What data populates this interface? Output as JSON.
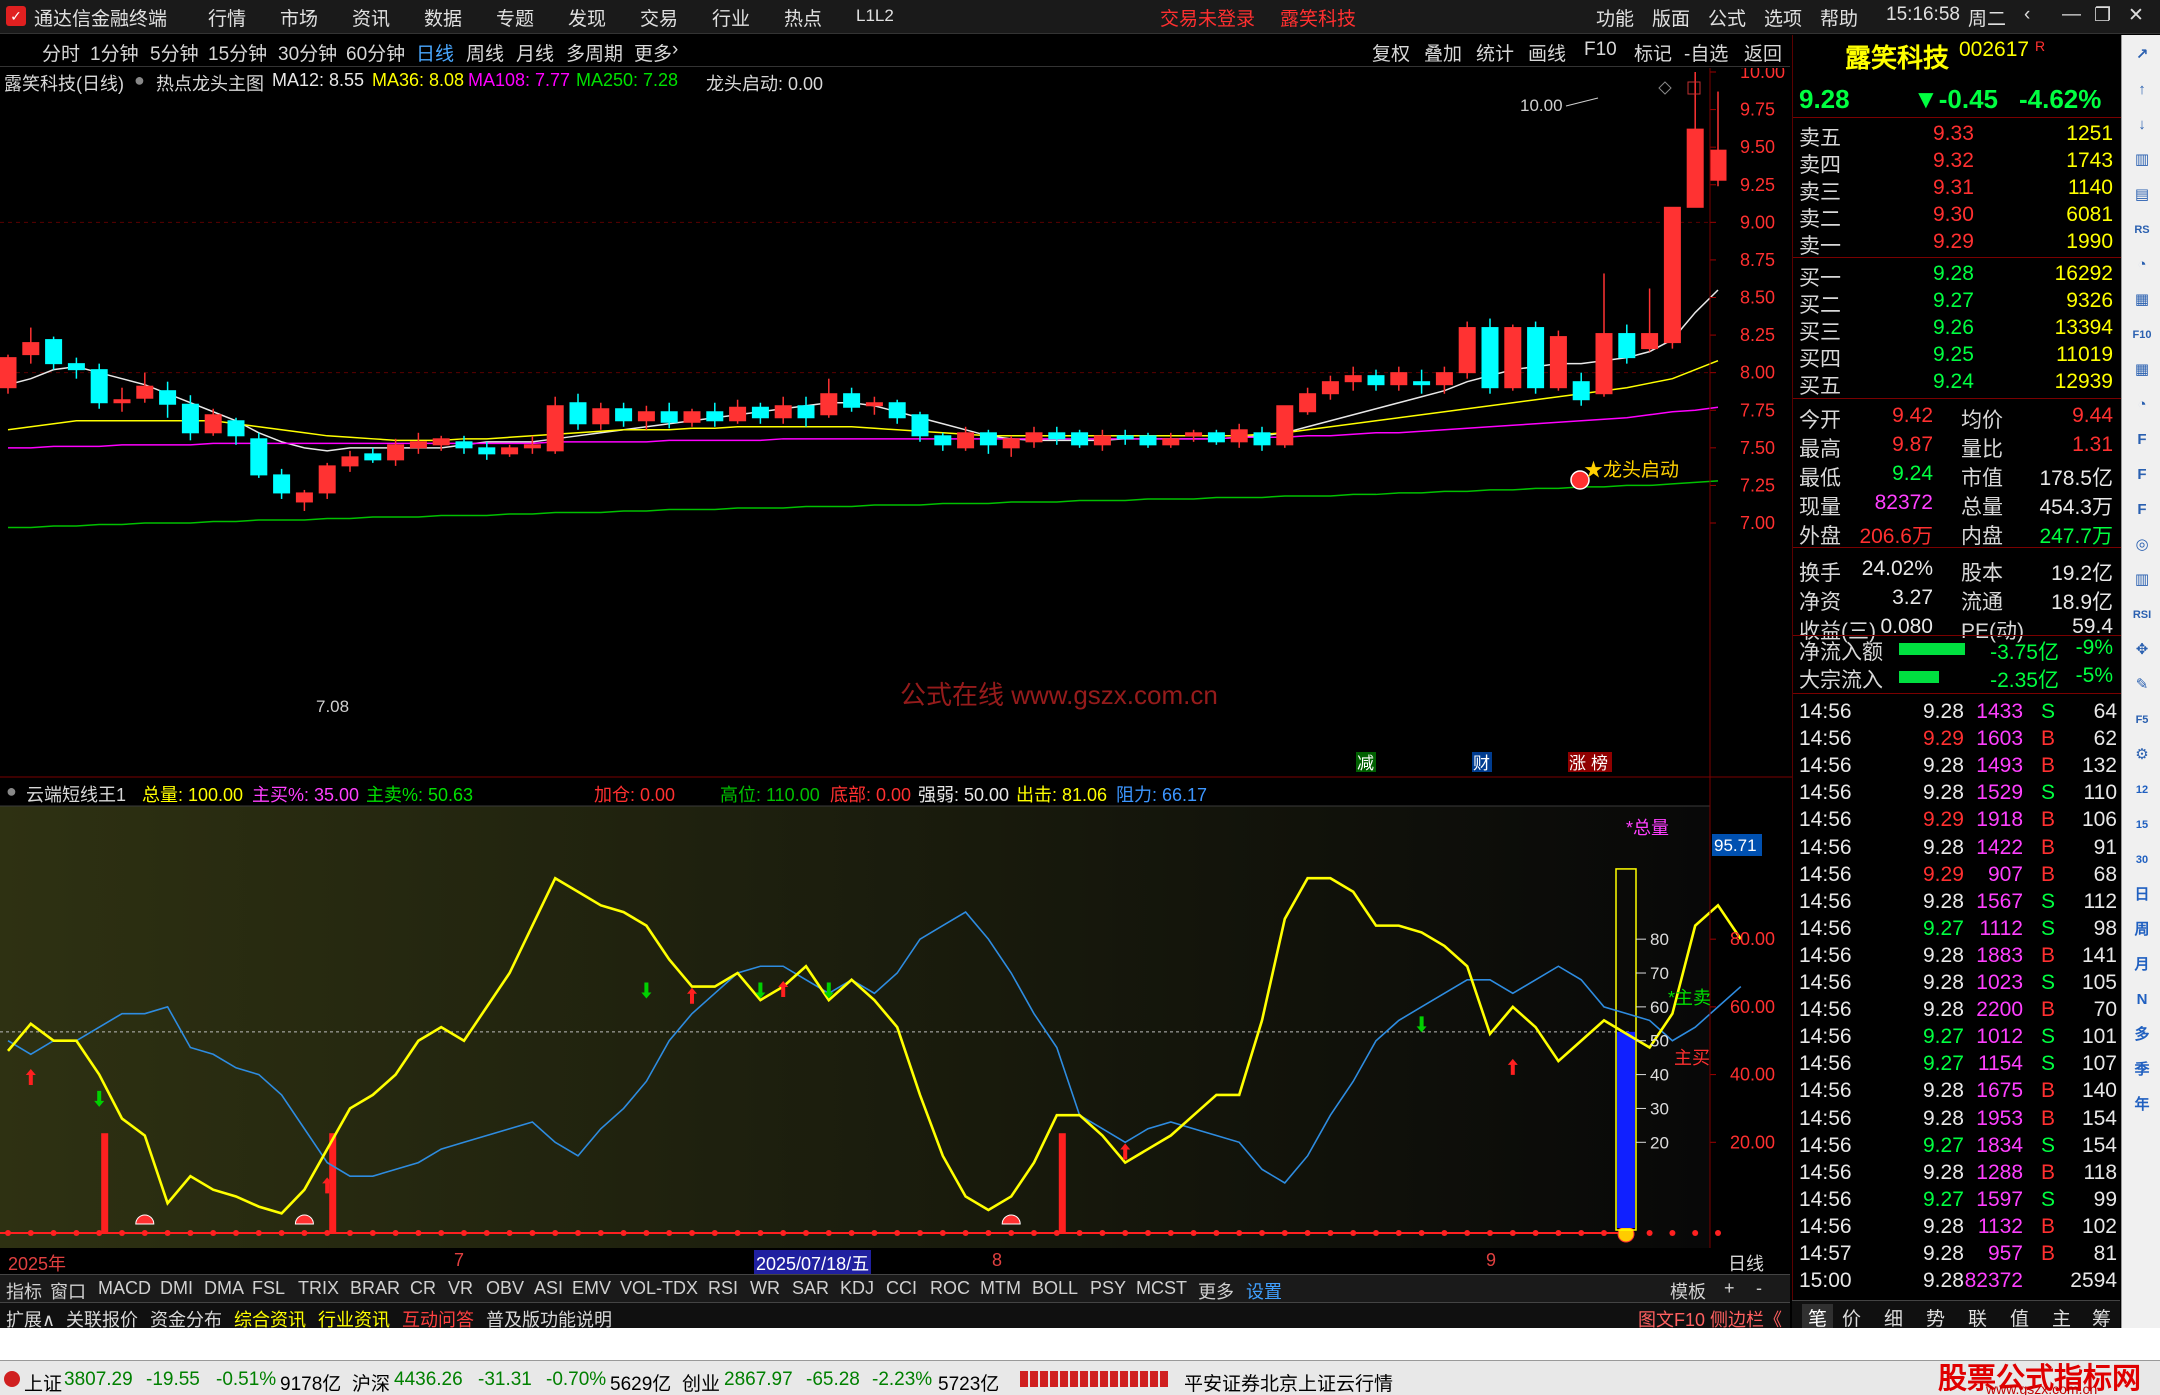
{
  "app": {
    "title": "通达信金融终端",
    "menu": [
      "行情",
      "市场",
      "资讯",
      "数据",
      "专题",
      "发现",
      "交易",
      "行业",
      "热点",
      "L1L2"
    ],
    "trade_status": "交易未登录",
    "stock_name": "露笑科技",
    "right_menu": [
      "功能",
      "版面",
      "公式",
      "选项",
      "帮助"
    ],
    "clock": "15:16:58",
    "weekday": "周二"
  },
  "periods": {
    "items": [
      "分时",
      "1分钟",
      "5分钟",
      "15分钟",
      "30分钟",
      "60分钟",
      "日线",
      "周线",
      "月线",
      "多周期",
      "更多"
    ],
    "active": "日线",
    "tools": [
      "复权",
      "叠加",
      "统计",
      "画线",
      "F10",
      "标记",
      "-自选",
      "返回"
    ]
  },
  "main_info": {
    "title": "露笑科技(日线)",
    "template": "热点龙头主图",
    "ma12": "MA12: 8.55",
    "ma36": "MA36: 8.08",
    "ma108": "MA108: 7.77",
    "ma250": "MA250: 7.28",
    "signal": "龙头启动: 0.00",
    "hi_label": "10.00",
    "lo_label": "7.08",
    "marker_label": "★龙头启动",
    "watermark": "公式在线  www.gszx.com.cn",
    "badges": [
      "减",
      "财",
      "涨",
      "榜"
    ]
  },
  "price_axis": [
    "10.00",
    "9.75",
    "9.50",
    "9.25",
    "9.00",
    "8.75",
    "8.50",
    "8.25",
    "8.00",
    "7.75",
    "7.50",
    "7.25",
    "7.00"
  ],
  "sub_info": {
    "name": "云端短线王1",
    "total": "总量: 100.00",
    "buy_pct": "主买%: 35.00",
    "sell_pct": "主卖%: 50.63",
    "add": "加仓: 0.00",
    "high": "高位: 110.00",
    "bottom": "底部: 0.00",
    "strong": "强弱: 50.00",
    "out": "出击: 81.06",
    "resist": "阻力: 66.17",
    "flag_total": "*总量",
    "flag_sell": "*主卖",
    "flag_buy": "主买",
    "value_tag": "95.71"
  },
  "sub_axis": [
    "80.00",
    "60.00",
    "40.00",
    "20.00"
  ],
  "sub_inner_axis": [
    "80",
    "70",
    "60",
    "50",
    "40",
    "30",
    "20"
  ],
  "dates": {
    "year": "2025年",
    "m7": "7",
    "cursor": "2025/07/18/五",
    "m8": "8",
    "m9": "9",
    "period": "日线"
  },
  "indicator_tabs": [
    "指标",
    "窗口",
    "MACD",
    "DMI",
    "DMA",
    "FSL",
    "TRIX",
    "BRAR",
    "CR",
    "VR",
    "OBV",
    "ASI",
    "EMV",
    "VOL-TDX",
    "RSI",
    "WR",
    "SAR",
    "KDJ",
    "CCI",
    "ROC",
    "MTM",
    "BOLL",
    "PSY",
    "MCST",
    "更多",
    "设置"
  ],
  "indicator_right": [
    "模板",
    "+",
    "-"
  ],
  "ext_tabs": [
    "扩展∧",
    "关联报价",
    "资金分布",
    "综合资讯",
    "行业资讯",
    "互动问答",
    "普及版功能说明"
  ],
  "ext_right": "图文F10 侧边栏《",
  "quote": {
    "name": "露笑科技",
    "code": "002617",
    "flag": "R",
    "price": "9.28",
    "change": "▼-0.45",
    "pct": "-4.62%"
  },
  "asks": [
    [
      "卖五",
      "9.33",
      "1251"
    ],
    [
      "卖四",
      "9.32",
      "1743"
    ],
    [
      "卖三",
      "9.31",
      "1140"
    ],
    [
      "卖二",
      "9.30",
      "6081"
    ],
    [
      "卖一",
      "9.29",
      "1990"
    ]
  ],
  "bids": [
    [
      "买一",
      "9.28",
      "16292"
    ],
    [
      "买二",
      "9.27",
      "9326"
    ],
    [
      "买三",
      "9.26",
      "13394"
    ],
    [
      "买四",
      "9.25",
      "11019"
    ],
    [
      "买五",
      "9.24",
      "12939"
    ]
  ],
  "stats": [
    [
      "今开",
      "9.42",
      "均价",
      "9.44"
    ],
    [
      "最高",
      "9.87",
      "量比",
      "1.31"
    ],
    [
      "最低",
      "9.24",
      "市值",
      "178.5亿"
    ],
    [
      "现量",
      "82372",
      "总量",
      "454.3万"
    ],
    [
      "外盘",
      "206.6万",
      "内盘",
      "247.7万"
    ],
    [
      "换手",
      "24.02%",
      "股本",
      "19.2亿"
    ],
    [
      "净资",
      "3.27",
      "流通",
      "18.9亿"
    ],
    [
      "收益(三)",
      "0.080",
      "PE(动)",
      "59.4"
    ]
  ],
  "flows": [
    [
      "净流入额",
      "-3.75亿",
      "-9%"
    ],
    [
      "大宗流入",
      "-2.35亿",
      "-5%"
    ]
  ],
  "ticks": [
    [
      "14:56",
      "9.28",
      "1433",
      "S",
      "64"
    ],
    [
      "14:56",
      "9.29",
      "1603",
      "B",
      "62"
    ],
    [
      "14:56",
      "9.28",
      "1493",
      "B",
      "132"
    ],
    [
      "14:56",
      "9.28",
      "1529",
      "S",
      "110"
    ],
    [
      "14:56",
      "9.29",
      "1918",
      "B",
      "106"
    ],
    [
      "14:56",
      "9.28",
      "1422",
      "B",
      "91"
    ],
    [
      "14:56",
      "9.29",
      "907",
      "B",
      "68"
    ],
    [
      "14:56",
      "9.28",
      "1567",
      "S",
      "112"
    ],
    [
      "14:56",
      "9.27",
      "1112",
      "S",
      "98"
    ],
    [
      "14:56",
      "9.28",
      "1883",
      "B",
      "141"
    ],
    [
      "14:56",
      "9.28",
      "1023",
      "S",
      "105"
    ],
    [
      "14:56",
      "9.28",
      "2200",
      "B",
      "70"
    ],
    [
      "14:56",
      "9.27",
      "1012",
      "S",
      "101"
    ],
    [
      "14:56",
      "9.27",
      "1154",
      "S",
      "107"
    ],
    [
      "14:56",
      "9.28",
      "1675",
      "B",
      "140"
    ],
    [
      "14:56",
      "9.28",
      "1953",
      "B",
      "154"
    ],
    [
      "14:56",
      "9.27",
      "1834",
      "S",
      "154"
    ],
    [
      "14:56",
      "9.28",
      "1288",
      "B",
      "118"
    ],
    [
      "14:56",
      "9.27",
      "1597",
      "S",
      "99"
    ],
    [
      "14:56",
      "9.28",
      "1132",
      "B",
      "102"
    ],
    [
      "14:57",
      "9.28",
      "957",
      "B",
      "81"
    ],
    [
      "15:00",
      "9.28",
      "82372",
      "",
      "2594"
    ]
  ],
  "right_tabs": [
    "笔",
    "价",
    "细",
    "势",
    "联",
    "值",
    "主",
    "筹"
  ],
  "side_icons": [
    "↗",
    "↑",
    "↓",
    "▥",
    "▤",
    "RS",
    "◔",
    "▦",
    "F10",
    "▦",
    "◔",
    "F",
    "F",
    "F",
    "◎",
    "▥",
    "RSI",
    "✥",
    "✎",
    "F5",
    "⚙",
    "12",
    "15",
    "30",
    "日",
    "周",
    "月",
    "N",
    "多",
    "季",
    "年"
  ],
  "status": {
    "sh_name": "上证",
    "sh_val": "3807.29",
    "sh_chg": "-19.55",
    "sh_pct": "-0.51%",
    "sh_amt": "9178亿",
    "sz_name": "沪深",
    "sz_val": "4436.26",
    "sz_chg": "-31.31",
    "sz_pct": "-0.70%",
    "sz_amt": "5629亿",
    "cy_name": "创业",
    "cy_val": "2867.97",
    "cy_chg": "-65.28",
    "cy_pct": "-2.23%",
    "cy_amt": "5723亿",
    "broker": "平安证券北京上证云行情",
    "brand": "股票公式指标网",
    "brand_url": "www.gszx.com.cn"
  },
  "colors": {
    "up": "#ff3232",
    "down": "#00ffff",
    "yellow": "#ffff00",
    "green": "#00e000",
    "magenta": "#ff00ff",
    "blue": "#3c96ff",
    "panel_red": "#7a0000"
  },
  "chart_data": {
    "type": "candlestick",
    "candles": [
      [
        7.9,
        8.1,
        7.86,
        8.12
      ],
      [
        8.12,
        8.2,
        8.06,
        8.3
      ],
      [
        8.22,
        8.06,
        8.02,
        8.24
      ],
      [
        8.06,
        8.02,
        7.96,
        8.1
      ],
      [
        8.02,
        7.8,
        7.76,
        8.06
      ],
      [
        7.8,
        7.82,
        7.74,
        7.9
      ],
      [
        7.83,
        7.91,
        7.8,
        8.0
      ],
      [
        7.88,
        7.79,
        7.7,
        7.94
      ],
      [
        7.79,
        7.6,
        7.55,
        7.85
      ],
      [
        7.6,
        7.72,
        7.58,
        7.76
      ],
      [
        7.68,
        7.58,
        7.52,
        7.7
      ],
      [
        7.56,
        7.32,
        7.3,
        7.6
      ],
      [
        7.32,
        7.2,
        7.16,
        7.36
      ],
      [
        7.14,
        7.2,
        7.08,
        7.22
      ],
      [
        7.2,
        7.38,
        7.16,
        7.4
      ],
      [
        7.38,
        7.44,
        7.34,
        7.48
      ],
      [
        7.46,
        7.42,
        7.4,
        7.5
      ],
      [
        7.42,
        7.52,
        7.38,
        7.56
      ],
      [
        7.5,
        7.54,
        7.46,
        7.6
      ],
      [
        7.52,
        7.56,
        7.48,
        7.58
      ],
      [
        7.54,
        7.5,
        7.46,
        7.58
      ],
      [
        7.5,
        7.46,
        7.42,
        7.54
      ],
      [
        7.46,
        7.5,
        7.44,
        7.52
      ],
      [
        7.5,
        7.52,
        7.46,
        7.58
      ],
      [
        7.48,
        7.78,
        7.46,
        7.84
      ],
      [
        7.8,
        7.66,
        7.62,
        7.86
      ],
      [
        7.66,
        7.76,
        7.62,
        7.8
      ],
      [
        7.76,
        7.68,
        7.64,
        7.8
      ],
      [
        7.68,
        7.74,
        7.62,
        7.78
      ],
      [
        7.74,
        7.67,
        7.63,
        7.8
      ],
      [
        7.67,
        7.74,
        7.64,
        7.76
      ],
      [
        7.74,
        7.68,
        7.64,
        7.8
      ],
      [
        7.68,
        7.77,
        7.66,
        7.82
      ],
      [
        7.77,
        7.7,
        7.66,
        7.8
      ],
      [
        7.7,
        7.78,
        7.66,
        7.84
      ],
      [
        7.78,
        7.7,
        7.64,
        7.84
      ],
      [
        7.72,
        7.86,
        7.7,
        7.96
      ],
      [
        7.86,
        7.77,
        7.74,
        7.9
      ],
      [
        7.78,
        7.8,
        7.72,
        7.84
      ],
      [
        7.8,
        7.7,
        7.66,
        7.82
      ],
      [
        7.72,
        7.58,
        7.54,
        7.74
      ],
      [
        7.58,
        7.52,
        7.48,
        7.6
      ],
      [
        7.5,
        7.6,
        7.48,
        7.64
      ],
      [
        7.6,
        7.52,
        7.46,
        7.62
      ],
      [
        7.5,
        7.56,
        7.44,
        7.58
      ],
      [
        7.54,
        7.6,
        7.5,
        7.64
      ],
      [
        7.6,
        7.56,
        7.52,
        7.64
      ],
      [
        7.6,
        7.52,
        7.5,
        7.62
      ],
      [
        7.52,
        7.58,
        7.48,
        7.62
      ],
      [
        7.58,
        7.56,
        7.52,
        7.62
      ],
      [
        7.58,
        7.52,
        7.5,
        7.6
      ],
      [
        7.52,
        7.56,
        7.5,
        7.6
      ],
      [
        7.58,
        7.6,
        7.54,
        7.62
      ],
      [
        7.6,
        7.54,
        7.52,
        7.62
      ],
      [
        7.54,
        7.62,
        7.5,
        7.66
      ],
      [
        7.6,
        7.52,
        7.48,
        7.64
      ],
      [
        7.52,
        7.78,
        7.5,
        7.78
      ],
      [
        7.74,
        7.86,
        7.72,
        7.9
      ],
      [
        7.86,
        7.94,
        7.82,
        7.98
      ],
      [
        7.94,
        7.98,
        7.88,
        8.04
      ],
      [
        7.98,
        7.92,
        7.88,
        8.02
      ],
      [
        7.92,
        8.0,
        7.88,
        8.04
      ],
      [
        7.94,
        7.92,
        7.86,
        8.02
      ],
      [
        7.92,
        8.0,
        7.86,
        8.04
      ],
      [
        8.0,
        8.3,
        7.96,
        8.34
      ],
      [
        8.3,
        7.9,
        7.86,
        8.36
      ],
      [
        7.9,
        8.3,
        7.88,
        8.32
      ],
      [
        8.3,
        7.9,
        7.86,
        8.34
      ],
      [
        7.9,
        8.24,
        7.88,
        8.28
      ],
      [
        7.94,
        7.82,
        7.78,
        8.0
      ],
      [
        7.86,
        8.26,
        7.84,
        8.66
      ],
      [
        8.26,
        8.1,
        8.06,
        8.32
      ],
      [
        8.16,
        8.26,
        8.14,
        8.56
      ],
      [
        8.2,
        9.1,
        8.16,
        9.1
      ],
      [
        9.1,
        9.62,
        9.38,
        10.0
      ],
      [
        9.28,
        9.48,
        9.24,
        9.87
      ]
    ],
    "ma12": [
      7.92,
      7.96,
      8.02,
      8.04,
      8.0,
      7.96,
      7.92,
      7.86,
      7.8,
      7.74,
      7.68,
      7.6,
      7.54,
      7.5,
      7.48,
      7.5,
      7.5,
      7.5,
      7.5,
      7.5,
      7.52,
      7.54,
      7.54,
      7.54,
      7.56,
      7.58,
      7.6,
      7.62,
      7.64,
      7.66,
      7.68,
      7.7,
      7.72,
      7.74,
      7.76,
      7.78,
      7.8,
      7.8,
      7.78,
      7.74,
      7.7,
      7.66,
      7.62,
      7.58,
      7.56,
      7.55,
      7.55,
      7.55,
      7.55,
      7.56,
      7.56,
      7.56,
      7.56,
      7.56,
      7.57,
      7.58,
      7.6,
      7.64,
      7.68,
      7.72,
      7.76,
      7.8,
      7.84,
      7.88,
      7.94,
      7.98,
      8.02,
      8.04,
      8.06,
      8.06,
      8.08,
      8.1,
      8.14,
      8.22,
      8.4,
      8.55
    ],
    "ma36": [
      7.62,
      7.64,
      7.66,
      7.68,
      7.68,
      7.68,
      7.68,
      7.68,
      7.68,
      7.68,
      7.66,
      7.64,
      7.62,
      7.6,
      7.58,
      7.57,
      7.56,
      7.55,
      7.55,
      7.55,
      7.56,
      7.56,
      7.57,
      7.58,
      7.59,
      7.6,
      7.61,
      7.62,
      7.62,
      7.62,
      7.63,
      7.63,
      7.64,
      7.64,
      7.64,
      7.64,
      7.64,
      7.64,
      7.63,
      7.62,
      7.61,
      7.6,
      7.59,
      7.58,
      7.58,
      7.58,
      7.58,
      7.58,
      7.58,
      7.58,
      7.58,
      7.58,
      7.58,
      7.58,
      7.58,
      7.59,
      7.6,
      7.62,
      7.64,
      7.66,
      7.68,
      7.7,
      7.72,
      7.74,
      7.76,
      7.78,
      7.8,
      7.82,
      7.84,
      7.86,
      7.88,
      7.9,
      7.93,
      7.96,
      8.02,
      8.08
    ],
    "ma108": [
      7.5,
      7.5,
      7.51,
      7.51,
      7.51,
      7.52,
      7.52,
      7.52,
      7.52,
      7.53,
      7.53,
      7.53,
      7.53,
      7.53,
      7.53,
      7.53,
      7.53,
      7.53,
      7.53,
      7.53,
      7.53,
      7.53,
      7.53,
      7.53,
      7.54,
      7.54,
      7.54,
      7.54,
      7.54,
      7.55,
      7.55,
      7.55,
      7.55,
      7.55,
      7.56,
      7.56,
      7.56,
      7.56,
      7.56,
      7.56,
      7.56,
      7.56,
      7.56,
      7.56,
      7.56,
      7.56,
      7.56,
      7.56,
      7.56,
      7.56,
      7.56,
      7.56,
      7.56,
      7.56,
      7.57,
      7.57,
      7.57,
      7.58,
      7.58,
      7.59,
      7.6,
      7.6,
      7.61,
      7.62,
      7.63,
      7.64,
      7.65,
      7.66,
      7.67,
      7.68,
      7.69,
      7.7,
      7.72,
      7.74,
      7.75,
      7.77
    ],
    "ma250": [
      6.97,
      6.97,
      6.98,
      6.98,
      6.99,
      6.99,
      7.0,
      7.0,
      7.0,
      7.01,
      7.01,
      7.02,
      7.02,
      7.02,
      7.03,
      7.03,
      7.04,
      7.04,
      7.04,
      7.05,
      7.05,
      7.05,
      7.06,
      7.06,
      7.07,
      7.07,
      7.07,
      7.08,
      7.08,
      7.09,
      7.09,
      7.09,
      7.1,
      7.1,
      7.1,
      7.11,
      7.11,
      7.11,
      7.12,
      7.12,
      7.12,
      7.13,
      7.13,
      7.13,
      7.14,
      7.14,
      7.14,
      7.15,
      7.15,
      7.15,
      7.16,
      7.16,
      7.16,
      7.17,
      7.17,
      7.17,
      7.18,
      7.18,
      7.18,
      7.19,
      7.19,
      7.2,
      7.2,
      7.21,
      7.21,
      7.22,
      7.22,
      7.23,
      7.23,
      7.24,
      7.24,
      7.25,
      7.25,
      7.26,
      7.27,
      7.28
    ],
    "ylim": [
      7.0,
      10.0
    ],
    "yellow": [
      47,
      55,
      50,
      50,
      40,
      27,
      22,
      2,
      10,
      6,
      4,
      1,
      -1,
      6,
      18,
      30,
      34,
      40,
      50,
      54,
      50,
      60,
      70,
      84,
      98,
      94,
      90,
      88,
      84,
      74,
      66,
      66,
      70,
      62,
      66,
      72,
      62,
      68,
      62,
      54,
      34,
      16,
      4,
      0,
      4,
      14,
      28,
      28,
      22,
      14,
      18,
      22,
      28,
      34,
      34,
      56,
      86,
      98,
      98,
      94,
      84,
      84,
      82,
      78,
      72,
      52,
      60,
      54,
      44,
      50,
      56,
      52,
      48,
      58,
      84,
      90,
      80
    ],
    "blue": [
      50,
      46,
      50,
      50,
      54,
      58,
      58,
      60,
      48,
      46,
      42,
      40,
      34,
      24,
      14,
      10,
      10,
      12,
      14,
      18,
      20,
      22,
      24,
      26,
      20,
      16,
      24,
      30,
      38,
      50,
      58,
      64,
      70,
      72,
      72,
      68,
      64,
      68,
      64,
      70,
      80,
      84,
      88,
      80,
      70,
      58,
      48,
      28,
      24,
      20,
      24,
      26,
      24,
      22,
      20,
      12,
      8,
      16,
      28,
      38,
      50,
      56,
      60,
      64,
      68,
      68,
      64,
      68,
      72,
      68,
      60,
      58,
      56,
      50,
      54,
      60,
      66
    ],
    "buy_arrows": [
      [
        1,
        44
      ],
      [
        14,
        12
      ],
      [
        30,
        68
      ],
      [
        34,
        70
      ],
      [
        49,
        22
      ],
      [
        66,
        47
      ]
    ],
    "sell_arrows": [
      [
        4,
        34
      ],
      [
        28,
        66
      ],
      [
        33,
        66
      ],
      [
        36,
        66
      ],
      [
        62,
        56
      ]
    ],
    "sub_ylim": [
      0,
      110
    ]
  }
}
